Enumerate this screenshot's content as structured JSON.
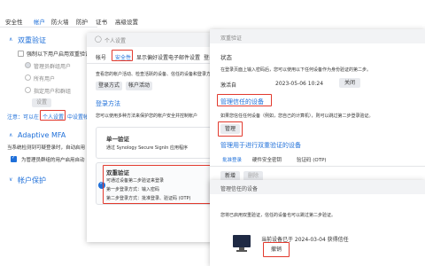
{
  "bg": {
    "tabs": [
      "安全性",
      "帐户",
      "防火墙",
      "防护",
      "证书",
      "高级设置"
    ],
    "two_factor_section": "双重验证",
    "enforce_label": "强制以下用户启用双重验证",
    "radio_options": [
      "管理员群组用户",
      "所有用户",
      "指定用户和群组"
    ],
    "settings_btn": "设置",
    "note_prefix": "注意：可以在",
    "note_link": "个人设置",
    "note_suffix": "中设置帐户",
    "adaptive_section": "Adaptive MFA",
    "adaptive_desc": "当系统检测到可疑登录时，自动启用",
    "adaptive_check": "为管理员群组的用户启用自动",
    "account_protect": "帐户保护"
  },
  "personal": {
    "title": "个人设置",
    "tabs": [
      "帐号",
      "安全性",
      "显示偏好设置",
      "电子邮件设置",
      "登录",
      "帐户活动"
    ],
    "desc": "查看您的帐户活动、检查活跃的设备、信任的设备和登录方式",
    "btn_login_method": "登录方式",
    "btn_activity": "帐户活动",
    "login_method_title": "登录方法",
    "login_method_desc": "您可以使用多种方法来保护您的帐户安全并控制帐户",
    "card1_title": "单一验证",
    "card1_desc": "通过 Synology Secure SignIn 应用程序",
    "card2_title": "双重验证",
    "card2_desc": "可通过设备第二步验证来登录",
    "card2_step1": "第一步登录方式：输入密码",
    "card2_step2": "第二步登录方式：批准登录、验证码 (OTP)"
  },
  "sw": {
    "title": "双重验证",
    "status_label": "状态",
    "status_desc": "在登录页面上输入密码后，您可以使用以下任何设备作为身份验证的第二步。",
    "enabled_label": "激活自",
    "enabled_date": "2023-05-06 10:24",
    "disable_btn": "关闭",
    "manage_trusted": "管理信任的设备",
    "manage_desc": "如果您信任任何设备（例如，您自己的计算机），则可以跳过第二步登录验证。",
    "manage_btn": "管理",
    "manage_2fa_devices": "管理用于进行双重验证的设备",
    "tabs": [
      "批准登录",
      "硬件安全密钥",
      "验证码 (OTP)"
    ],
    "add_btn": "新增",
    "delete_btn": "删除"
  },
  "trusted": {
    "title": "管理信任的设备",
    "desc": "您将已启用双重验证，信任的设备也可以跳过第二步验证。",
    "device_text": "当前设备已于 2024-03-04 获得信任",
    "revoke_btn": "撤销"
  }
}
